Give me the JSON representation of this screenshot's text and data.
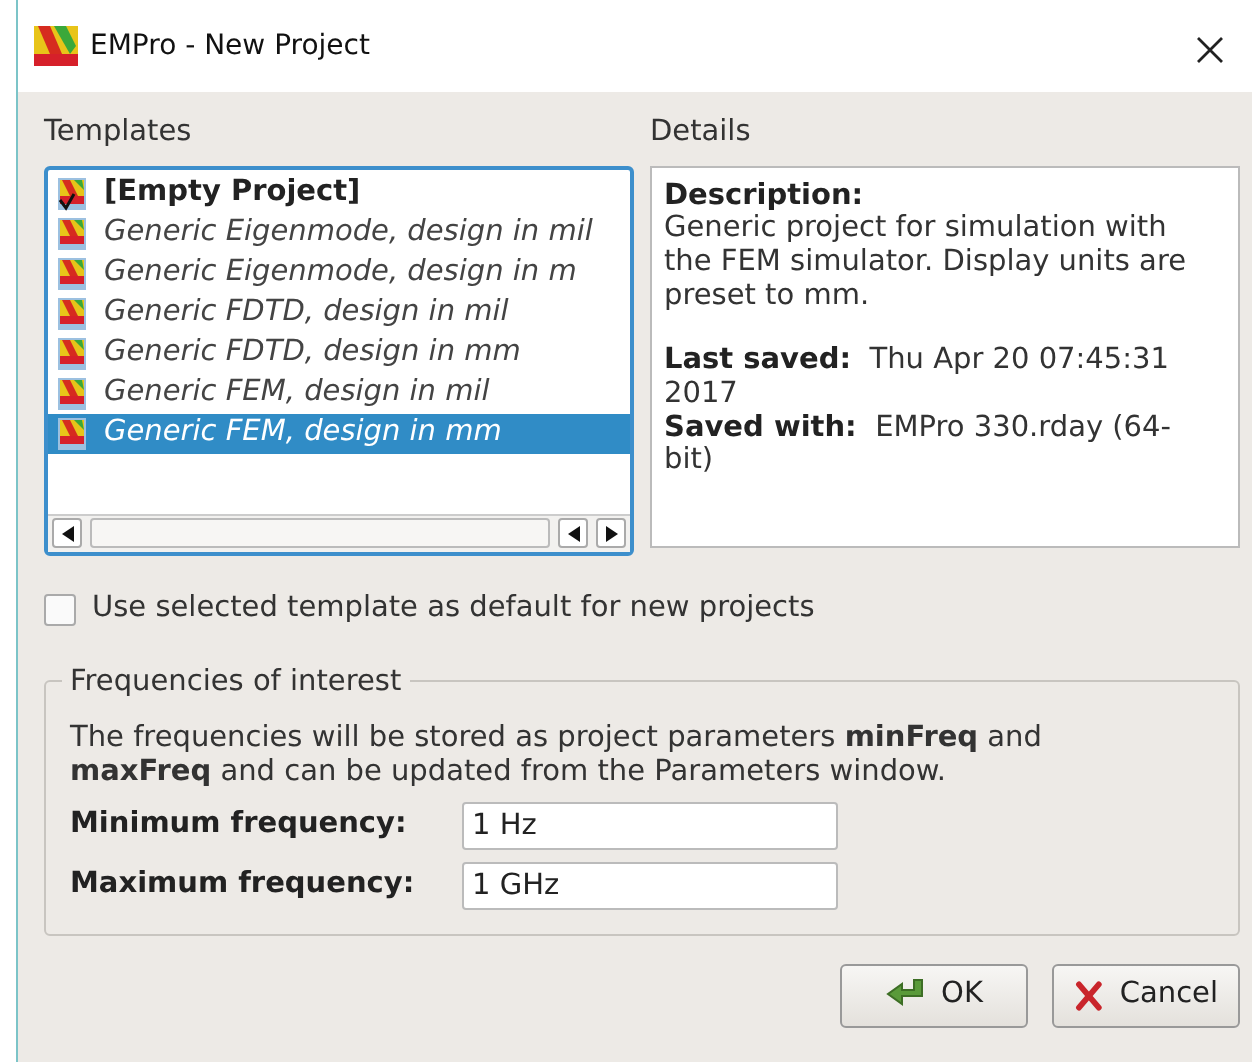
{
  "window": {
    "title": "EMPro - New Project"
  },
  "templates": {
    "label": "Templates",
    "items": [
      {
        "label": "[Empty Project]",
        "kind": "empty",
        "selected": false
      },
      {
        "label": "Generic Eigenmode, design in mil",
        "kind": "template",
        "selected": false
      },
      {
        "label": "Generic Eigenmode, design in m",
        "kind": "template",
        "selected": false
      },
      {
        "label": "Generic FDTD, design in mil",
        "kind": "template",
        "selected": false
      },
      {
        "label": "Generic FDTD, design in mm",
        "kind": "template",
        "selected": false
      },
      {
        "label": "Generic FEM, design in mil",
        "kind": "template",
        "selected": false
      },
      {
        "label": "Generic FEM, design in mm",
        "kind": "template",
        "selected": true
      }
    ]
  },
  "details": {
    "label": "Details",
    "description_label": "Description:",
    "description": "Generic project for simulation with the FEM simulator. Display units are preset to mm.",
    "last_saved_label": "Last saved:",
    "last_saved": "Thu Apr 20 07:45:31 2017",
    "saved_with_label": "Saved with:",
    "saved_with": "EMPro 330.rday (64-bit)"
  },
  "default_checkbox": {
    "label": "Use selected template as default for new projects",
    "checked": false
  },
  "frequencies": {
    "title": "Frequencies of interest",
    "note": "The frequencies will be stored as project parameters **minFreq** and **maxFreq** and can be updated from the Parameters window.",
    "fields": [
      {
        "label": "Minimum frequency:",
        "value": "1 Hz"
      },
      {
        "label": "Maximum frequency:",
        "value": "1 GHz"
      }
    ]
  },
  "buttons": [
    {
      "label": "OK",
      "kind": "ok"
    },
    {
      "label": "Cancel",
      "kind": "cancel"
    }
  ]
}
